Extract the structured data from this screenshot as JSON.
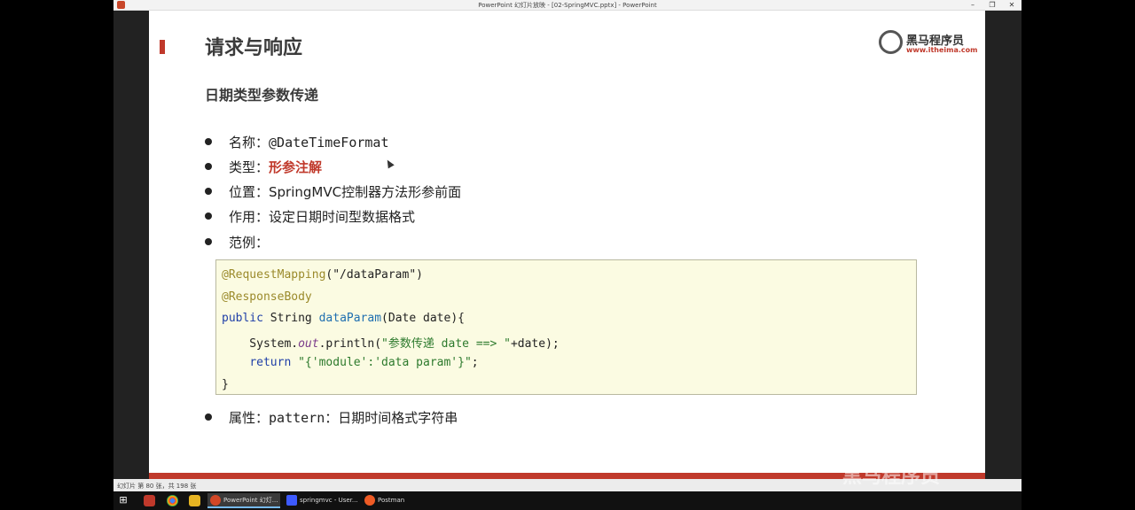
{
  "window": {
    "title": "PowerPoint 幻灯片放映 - [02-SpringMVC.pptx] - PowerPoint"
  },
  "slide": {
    "title": "请求与响应",
    "logo": {
      "brand": "黑马程序员",
      "url": "www.itheima.com"
    },
    "subtitle": "日期类型参数传递",
    "bullets": [
      {
        "label": "名称：",
        "value": "@DateTimeFormat"
      },
      {
        "label": "类型：",
        "value": "形参注解"
      },
      {
        "label": "位置：",
        "value": "SpringMVC控制器方法形参前面"
      },
      {
        "label": "作用：",
        "value": "设定日期时间型数据格式"
      },
      {
        "label": "范例：",
        "value": ""
      }
    ],
    "code": {
      "l1_ann": "@RequestMapping",
      "l1_rest": "(\"/dataParam\")",
      "l2_ann": "@ResponseBody",
      "l3_kw": "public",
      "l3_type": " String ",
      "l3_fn": "dataParam",
      "l3_rest": "(Date date){",
      "l4_pre": "    System.",
      "l4_it": "out",
      "l4_mid": ".println(",
      "l4_str": "\"参数传递 date ==> \"",
      "l4_rest": "+date);",
      "l5_pre": "    ",
      "l5_kw": "return",
      "l5_sp": " ",
      "l5_str": "\"{'module':'data param'}\"",
      "l5_rest": ";",
      "l6": "}"
    },
    "last_bullet": {
      "label": "属性：",
      "value": "pattern：日期时间格式字符串"
    }
  },
  "statusbar": {
    "text": "幻灯片 第 80 张，共 198 张"
  },
  "taskbar": {
    "tasks": [
      "PowerPoint 幻灯...",
      "springmvc - User...",
      "Postman"
    ]
  },
  "watermark": "黑马程序员"
}
